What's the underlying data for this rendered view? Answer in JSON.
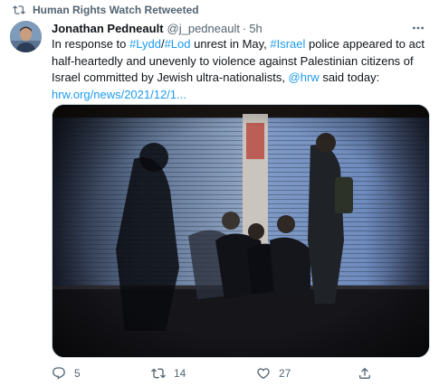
{
  "retweet": {
    "label": "Human Rights Watch Retweeted",
    "icon": "retweet-icon"
  },
  "author": {
    "name": "Jonathan Pedneault",
    "handle": "@j_pedneault",
    "separator": "·",
    "time": "5h"
  },
  "tweet": {
    "t1": "In response to ",
    "h1": "#Lydd",
    "t2": "/",
    "h2": "#Lod",
    "t3": " unrest in May, ",
    "h3": "#Israel",
    "t4": " police appeared to act half-heartedly and unevenly to violence against Palestinian citizens of Israel committed by Jewish ultra-nationalists, ",
    "mention": "@hrw",
    "t5": " said today:",
    "url": "hrw.org/news/2021/12/1..."
  },
  "media": {
    "icon": "photo"
  },
  "actions": {
    "reply_count": "5",
    "retweet_count": "14",
    "like_count": "27"
  },
  "colors": {
    "link": "#1d9bf0",
    "secondary_text": "#536471",
    "primary_text": "#0f1419"
  }
}
